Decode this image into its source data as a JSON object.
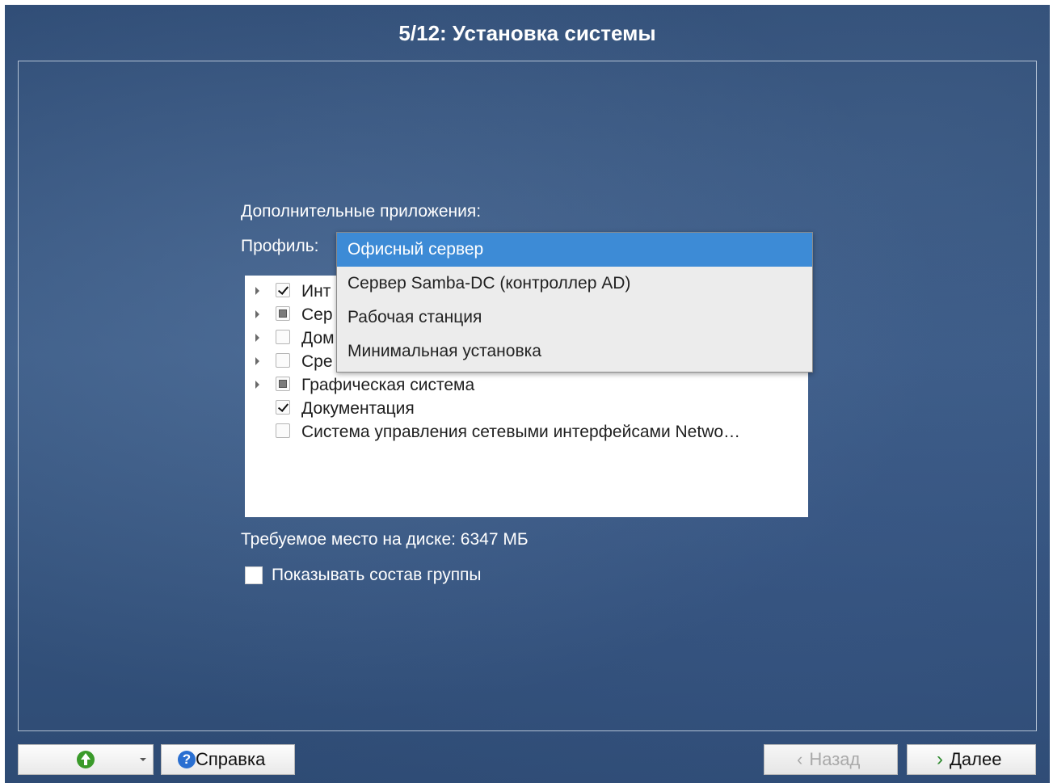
{
  "window": {
    "title": "5/12: Установка системы"
  },
  "main": {
    "section_label": "Дополнительные приложения:",
    "profile_label": "Профиль:",
    "profile_options": [
      {
        "label": "Офисный сервер",
        "selected": true
      },
      {
        "label": "Сервер Samba-DC (контроллер AD)",
        "selected": false
      },
      {
        "label": "Рабочая станция",
        "selected": false
      },
      {
        "label": "Минимальная установка",
        "selected": false
      }
    ],
    "groups": [
      {
        "label": "Интернет",
        "visible_label": "Инт",
        "state": "checked",
        "expandable": true
      },
      {
        "label": "Серверы",
        "visible_label": "Сер",
        "state": "partial",
        "expandable": true
      },
      {
        "label": "Домашние",
        "visible_label": "Дом",
        "state": "unchecked",
        "expandable": true
      },
      {
        "label": "Среда",
        "visible_label": "Сре",
        "state": "unchecked",
        "expandable": true
      },
      {
        "label": "Графическая система",
        "visible_label": "Графическая система",
        "state": "partial",
        "expandable": true
      },
      {
        "label": "Документация",
        "visible_label": "Документация",
        "state": "checked",
        "expandable": false
      },
      {
        "label": "Система управления сетевыми интерфейсами Netwo…",
        "visible_label": "Система управления сетевыми интерфейсами Netwo…",
        "state": "unchecked",
        "expandable": false
      }
    ],
    "disk_space": "Требуемое место на диске: 6347 МБ",
    "show_group_label": "Показывать состав группы",
    "show_group_checked": false
  },
  "footer": {
    "help_label": "Справка",
    "back_label": "Назад",
    "next_label": "Далее",
    "back_enabled": false
  },
  "colors": {
    "selection": "#3d8bd6",
    "background": "#2f4c75"
  }
}
